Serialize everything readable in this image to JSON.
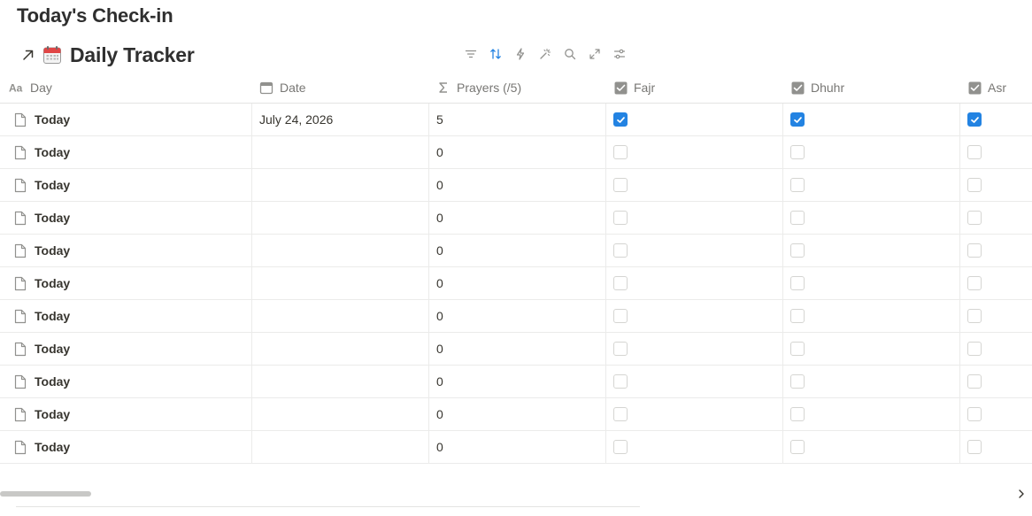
{
  "page": {
    "title": "Today's Check-in"
  },
  "database": {
    "title": "Daily Tracker",
    "icon": "calendar-emoji-icon",
    "link_icon": "arrow-up-right-icon"
  },
  "toolbar": {
    "icons": [
      "filter-icon",
      "sort-icon",
      "automation-bolt-icon",
      "magic-wand-icon",
      "search-icon",
      "expand-icon",
      "settings-sliders-icon"
    ],
    "active_color": "#2383e2",
    "icon_color": "#91918e"
  },
  "columns": {
    "day": {
      "label": "Day",
      "icon": "text-property-icon"
    },
    "date": {
      "label": "Date",
      "icon": "calendar-property-icon"
    },
    "prayers": {
      "label": "Prayers (/5)",
      "icon": "sigma-formula-icon"
    },
    "fajr": {
      "label": "Fajr",
      "icon": "checkbox-property-icon"
    },
    "dhuhr": {
      "label": "Dhuhr",
      "icon": "checkbox-property-icon"
    },
    "asr": {
      "label": "Asr",
      "icon": "checkbox-property-icon"
    }
  },
  "rows": [
    {
      "day": "Today",
      "date": "July 24, 2026",
      "prayers": "5",
      "fajr": true,
      "dhuhr": true,
      "asr": true
    },
    {
      "day": "Today",
      "date": "",
      "prayers": "0",
      "fajr": false,
      "dhuhr": false,
      "asr": false
    },
    {
      "day": "Today",
      "date": "",
      "prayers": "0",
      "fajr": false,
      "dhuhr": false,
      "asr": false
    },
    {
      "day": "Today",
      "date": "",
      "prayers": "0",
      "fajr": false,
      "dhuhr": false,
      "asr": false
    },
    {
      "day": "Today",
      "date": "",
      "prayers": "0",
      "fajr": false,
      "dhuhr": false,
      "asr": false
    },
    {
      "day": "Today",
      "date": "",
      "prayers": "0",
      "fajr": false,
      "dhuhr": false,
      "asr": false
    },
    {
      "day": "Today",
      "date": "",
      "prayers": "0",
      "fajr": false,
      "dhuhr": false,
      "asr": false
    },
    {
      "day": "Today",
      "date": "",
      "prayers": "0",
      "fajr": false,
      "dhuhr": false,
      "asr": false
    },
    {
      "day": "Today",
      "date": "",
      "prayers": "0",
      "fajr": false,
      "dhuhr": false,
      "asr": false
    },
    {
      "day": "Today",
      "date": "",
      "prayers": "0",
      "fajr": false,
      "dhuhr": false,
      "asr": false
    },
    {
      "day": "Today",
      "date": "",
      "prayers": "0",
      "fajr": false,
      "dhuhr": false,
      "asr": false
    }
  ],
  "colors": {
    "checkbox_checked": "#2383e2",
    "border": "#ebebea",
    "muted_text": "#787774"
  }
}
